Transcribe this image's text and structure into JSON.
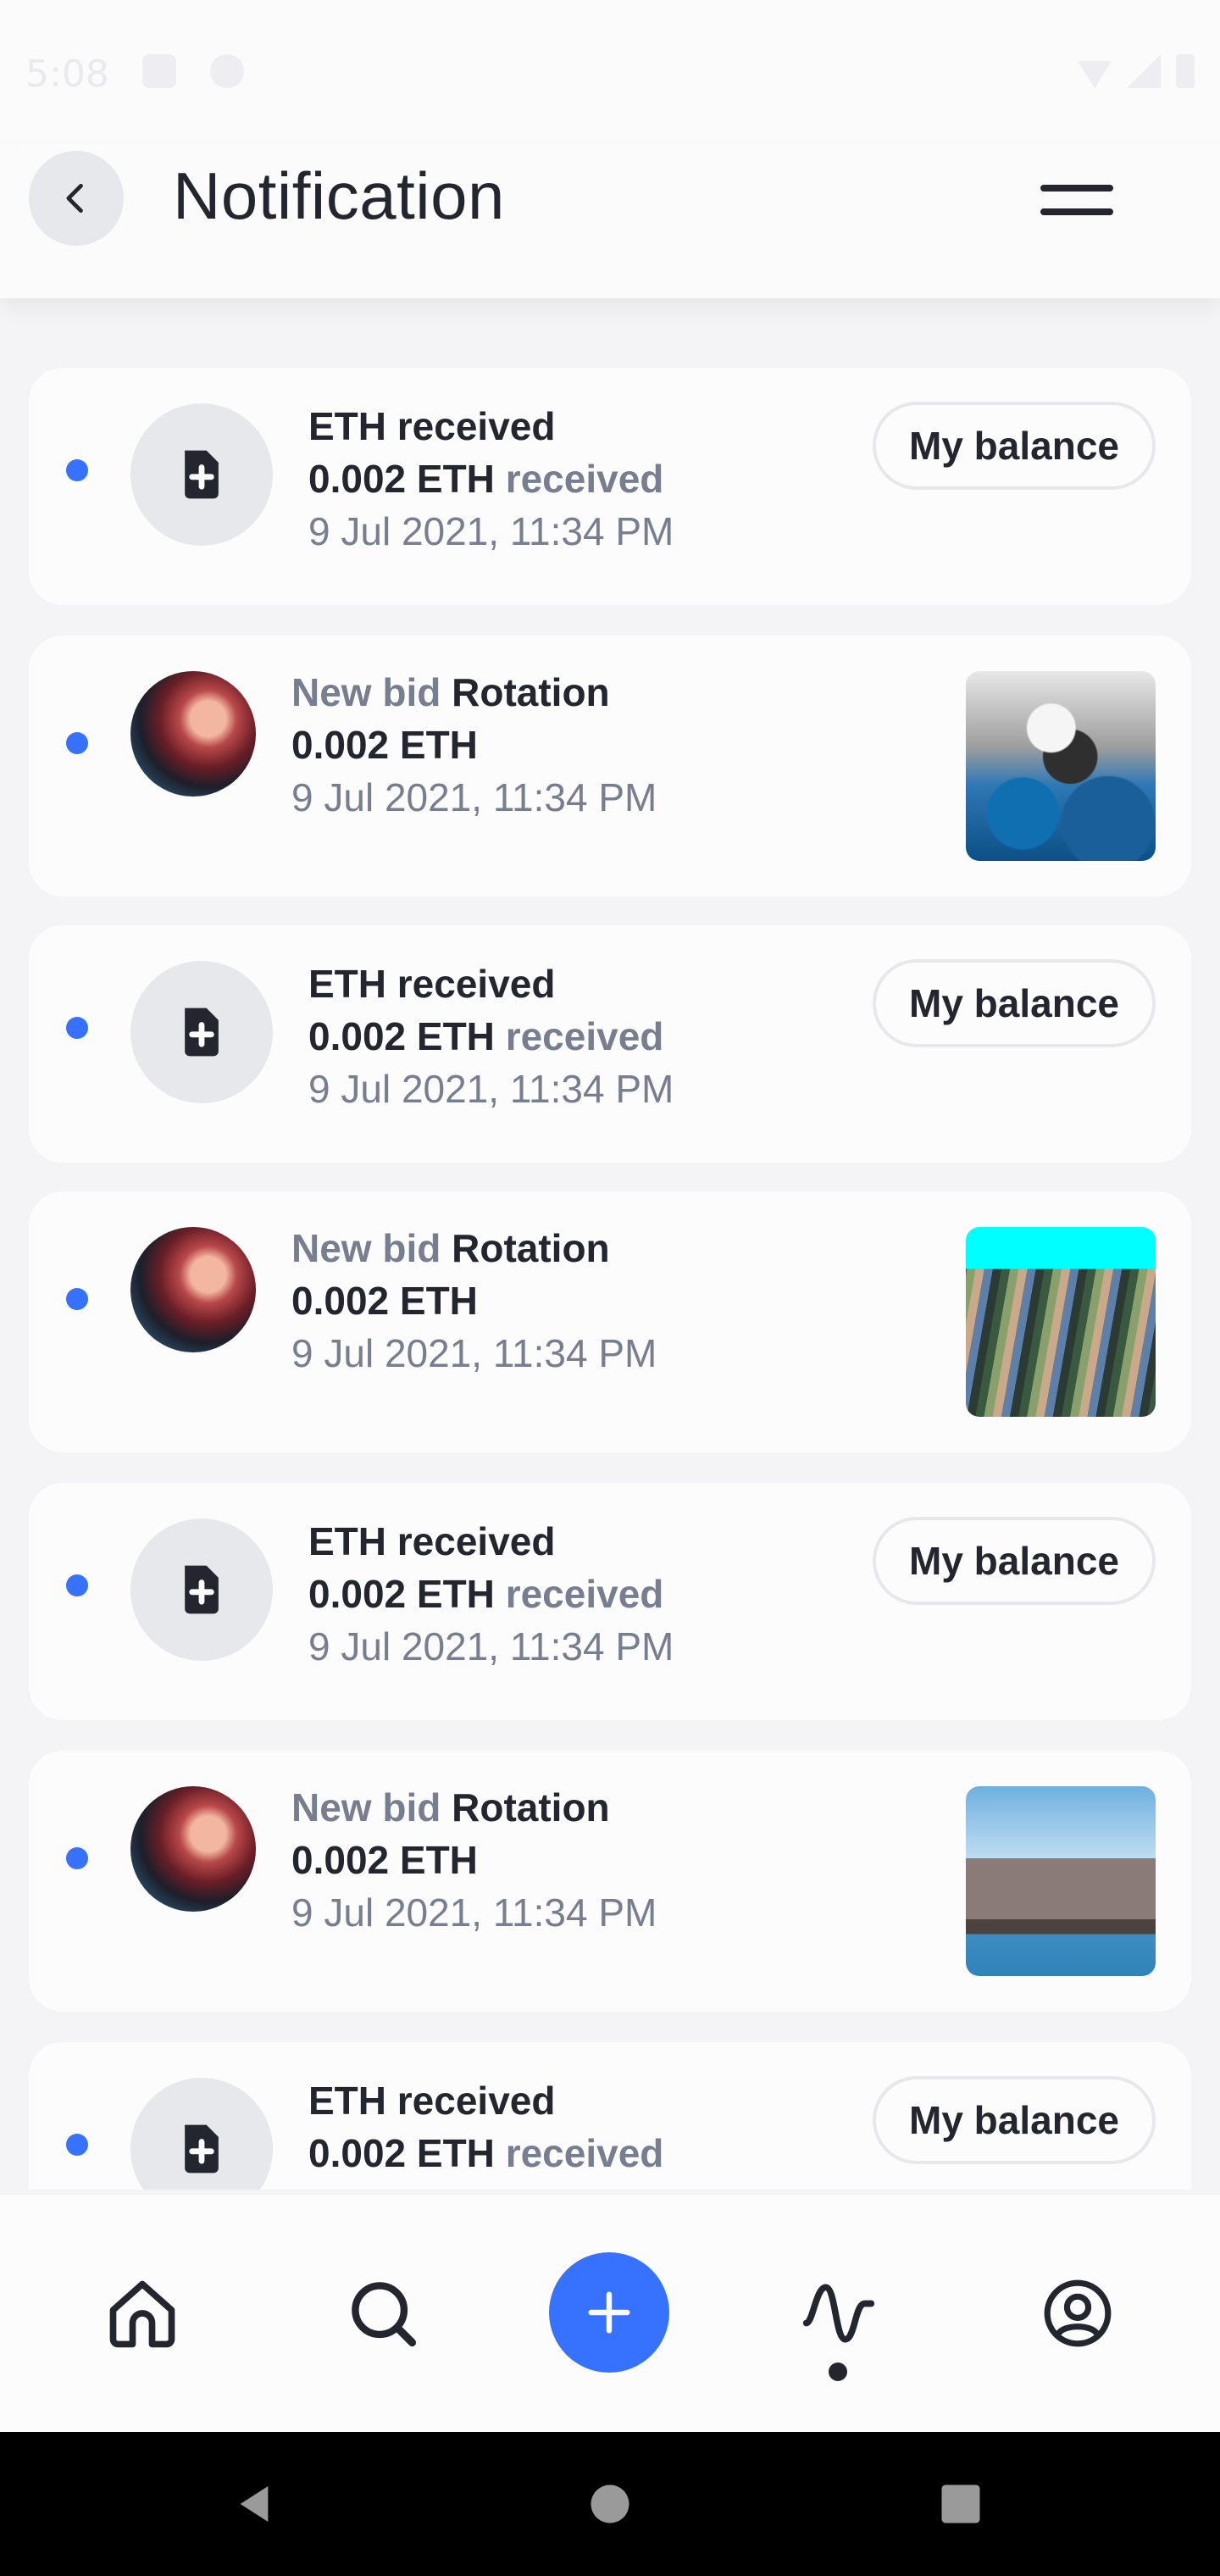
{
  "status_bar": {
    "time": "5:08"
  },
  "header": {
    "title": "Notification"
  },
  "colors": {
    "accent": "#3772ff",
    "text": "#23262f",
    "muted": "#777e90"
  },
  "notifications": [
    {
      "type": "eth_received",
      "title": "ETH received",
      "amount": "0.002 ETH",
      "suffix": "received",
      "date": "9 Jul 2021, 11:34 PM",
      "action": "My balance"
    },
    {
      "type": "new_bid",
      "prefix": "New bid",
      "item": "Rotation",
      "amount": "0.002 ETH",
      "date": "9 Jul 2021, 11:34 PM"
    },
    {
      "type": "eth_received",
      "title": "ETH received",
      "amount": "0.002 ETH",
      "suffix": "received",
      "date": "9 Jul 2021, 11:34 PM",
      "action": "My balance"
    },
    {
      "type": "new_bid",
      "prefix": "New bid",
      "item": "Rotation",
      "amount": "0.002 ETH",
      "date": "9 Jul 2021, 11:34 PM"
    },
    {
      "type": "eth_received",
      "title": "ETH received",
      "amount": "0.002 ETH",
      "suffix": "received",
      "date": "9 Jul 2021, 11:34 PM",
      "action": "My balance"
    },
    {
      "type": "new_bid",
      "prefix": "New bid",
      "item": "Rotation",
      "amount": "0.002 ETH",
      "date": "9 Jul 2021, 11:34 PM"
    },
    {
      "type": "eth_received",
      "title": "ETH received",
      "amount": "0.002 ETH",
      "suffix": "received",
      "action": "My balance"
    }
  ],
  "bottom_nav": {
    "items": [
      "home-icon",
      "search-icon",
      "add-icon",
      "activity-icon",
      "profile-icon"
    ],
    "active": "activity-icon"
  }
}
